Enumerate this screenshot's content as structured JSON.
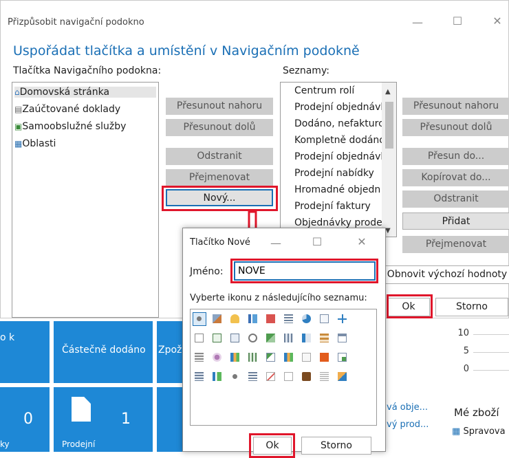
{
  "dialog": {
    "title": "Přizpůsobit navigační podokno",
    "window_controls": {
      "minimize": "—",
      "maximize": "☐",
      "close": "✕"
    },
    "heading": "Uspořádat tlačítka a umístění v Navigačním podokně",
    "left_label": "Tlačítka Navigačního podokna:",
    "right_label": "Seznamy:",
    "nav_buttons": [
      {
        "label": "Domovská stránka",
        "icon": "house-icon"
      },
      {
        "label": "Zaúčtované doklady",
        "icon": "document-icon"
      },
      {
        "label": "Samoobslužné služby",
        "icon": "self-service-icon"
      },
      {
        "label": "Oblasti",
        "icon": "areas-icon"
      }
    ],
    "left_buttons": {
      "move_up": "Přesunout nahoru",
      "move_down": "Přesunout dolů",
      "remove": "Odstranit",
      "rename": "Přejmenovat",
      "new": "Nový..."
    },
    "lists": [
      "Centrum rolí",
      "Prodejní objednávk",
      "Dodáno, nefakturc",
      "Kompletně dodáno",
      "Prodejní objednávk",
      "Prodejní nabídky",
      "Hromadné objedn",
      "Prodejní faktury",
      "Objednávky prode"
    ],
    "right_buttons": {
      "move_up": "Přesunout nahoru",
      "move_down": "Přesunout dolů",
      "move_to": "Přesun do...",
      "copy_to": "Kopírovat do...",
      "remove": "Odstranit",
      "add": "Přidat",
      "rename": "Přejmenovat"
    },
    "reset": "Obnovit výchozí hodnoty",
    "ok": "Ok",
    "cancel": "Storno"
  },
  "new_dialog": {
    "title": "Tlačítko Nové",
    "window_controls": {
      "minimize": "—",
      "maximize": "☐",
      "close": "✕"
    },
    "name_label": "Jméno:",
    "name_value": "NOVE",
    "icon_prompt": "Vyberte ikonu z následujícího seznamu:",
    "ok": "Ok",
    "cancel": "Storno"
  },
  "background": {
    "tile_left_label": "o k",
    "tile_partial_label": "Částečně dodáno",
    "tile_zpoz_label": "Zpož",
    "tile_zero": "0",
    "tile_one": "1",
    "tile_prodejni": "Prodejní",
    "tile_cut_label": "ky",
    "chart_ticks": [
      "10",
      "5",
      "0"
    ],
    "link_1": "vá obje...",
    "link_2": "vý prod...",
    "my_items": "Mé zboží",
    "manage": "Spravova"
  },
  "colors": {
    "accent": "#1a6fb5",
    "tile": "#1e88d6",
    "highlight": "#e0162b"
  }
}
